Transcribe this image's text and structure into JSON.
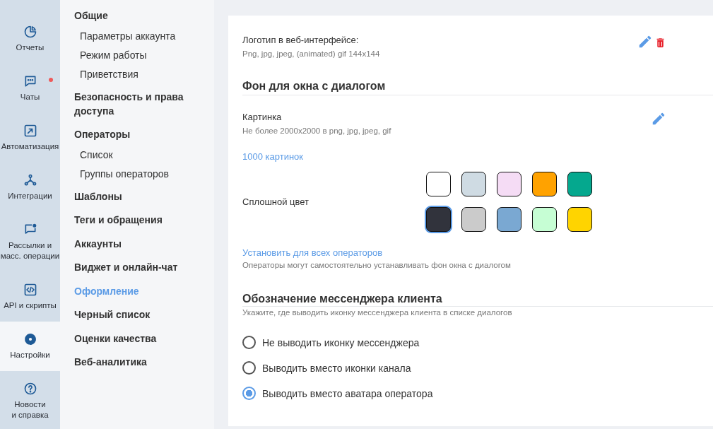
{
  "rail": [
    {
      "label": "Отчеты",
      "selected": false,
      "notification": false
    },
    {
      "label": "Чаты",
      "selected": false,
      "notification": true
    },
    {
      "label": "Автоматизация",
      "selected": false,
      "notification": false
    },
    {
      "label": "Интеграции",
      "selected": false,
      "notification": false
    },
    {
      "label": "Рассылки и\nмасс. операции",
      "selected": false,
      "notification": false
    },
    {
      "label": "API и скрипты",
      "selected": false,
      "notification": false
    },
    {
      "label": "Настройки",
      "selected": true,
      "notification": false
    },
    {
      "label": "Новости\nи справка",
      "selected": false,
      "notification": false
    }
  ],
  "menu": [
    {
      "label": "Общие",
      "selected": false,
      "children": [
        {
          "label": "Параметры аккаунта",
          "selected": false
        },
        {
          "label": "Режим работы",
          "selected": false
        },
        {
          "label": "Приветствия",
          "selected": false
        }
      ]
    },
    {
      "label": "Безопасность и права доступа",
      "selected": false
    },
    {
      "label": "Операторы",
      "selected": false,
      "children": [
        {
          "label": "Список",
          "selected": false
        },
        {
          "label": "Группы операторов",
          "selected": false
        }
      ]
    },
    {
      "label": "Шаблоны",
      "selected": false
    },
    {
      "label": "Теги и обращения",
      "selected": false
    },
    {
      "label": "Аккаунты",
      "selected": false
    },
    {
      "label": "Виджет и онлайн-чат",
      "selected": false
    },
    {
      "label": "Оформление",
      "selected": true
    },
    {
      "label": "Черный список",
      "selected": false
    },
    {
      "label": "Оценки качества",
      "selected": false
    },
    {
      "label": "Веб-аналитика",
      "selected": false
    }
  ],
  "logo": {
    "label": "Логотип в веб-интерфейсе:",
    "hint": "Png, jpg, jpeg, (animated) gif 144x144"
  },
  "background": {
    "heading": "Фон для окна с диалогом",
    "picture_label": "Картинка",
    "picture_hint": "Не более 2000x2000 в png, jpg, jpeg, gif",
    "gallery_link": "1000 картинок",
    "solid_label": "Сплошной цвет",
    "swatches": [
      {
        "color": "#ffffff",
        "selected": false
      },
      {
        "color": "#cfdbe3",
        "selected": false
      },
      {
        "color": "#f5dcf5",
        "selected": false
      },
      {
        "color": "#ffa200",
        "selected": false
      },
      {
        "color": "#05a88e",
        "selected": false
      },
      {
        "color": "#31333c",
        "selected": true
      },
      {
        "color": "#cbcbcb",
        "selected": false
      },
      {
        "color": "#7aa8d2",
        "selected": false
      },
      {
        "color": "#c6fed4",
        "selected": false
      },
      {
        "color": "#ffd400",
        "selected": false
      }
    ],
    "apply_link": "Установить для всех операторов",
    "apply_note": "Операторы могут самостоятельно устанавливать фон окна с диалогом"
  },
  "messenger": {
    "heading": "Обозначение мессенджера клиента",
    "hint": "Укажите, где выводить иконку мессенджера клиента в списке диалогов",
    "options": [
      {
        "label": "Не выводить иконку мессенджера",
        "selected": false
      },
      {
        "label": "Выводить вместо иконки канала",
        "selected": false
      },
      {
        "label": "Выводить вместо аватара оператора",
        "selected": true
      }
    ]
  }
}
